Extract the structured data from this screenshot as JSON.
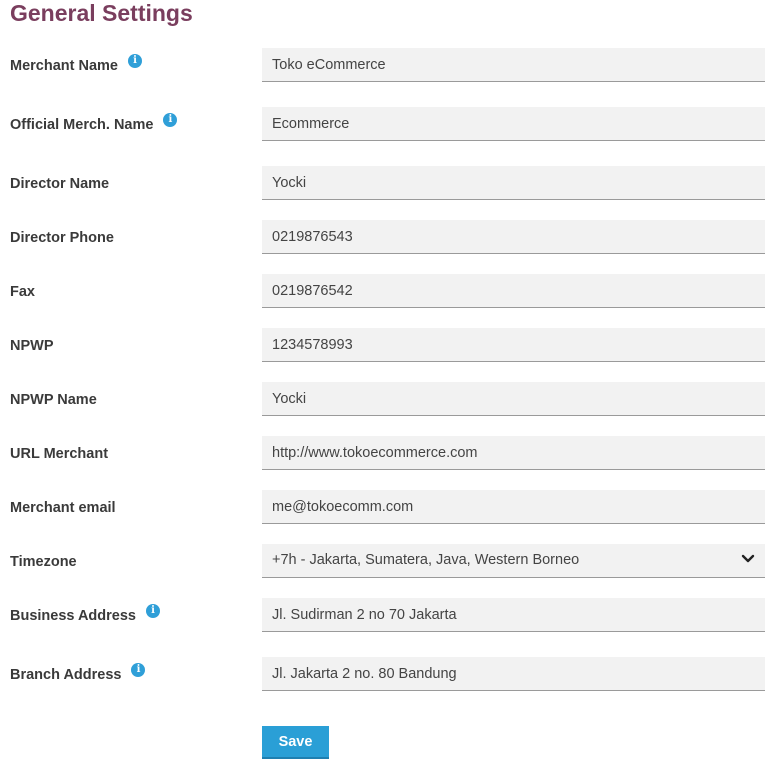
{
  "page": {
    "title": "General Settings"
  },
  "info_icon_glyph": "i",
  "form": {
    "merchant_name": {
      "label": "Merchant Name",
      "value": "Toko eCommerce"
    },
    "official_merchant_name": {
      "label": "Official Merch. Name",
      "value": "Ecommerce"
    },
    "director_name": {
      "label": "Director Name",
      "value": "Yocki"
    },
    "director_phone": {
      "label": "Director Phone",
      "value": "0219876543"
    },
    "fax": {
      "label": "Fax",
      "value": "0219876542"
    },
    "npwp": {
      "label": "NPWP",
      "value": "1234578993"
    },
    "npwp_name": {
      "label": "NPWP Name",
      "value": "Yocki"
    },
    "url_merchant": {
      "label": "URL Merchant",
      "value": "http://www.tokoecommerce.com"
    },
    "merchant_email": {
      "label": "Merchant email",
      "value": "me@tokoecomm.com"
    },
    "timezone": {
      "label": "Timezone",
      "value": "+7h - Jakarta, Sumatera, Java, Western Borneo"
    },
    "business_address": {
      "label": "Business Address",
      "value": "Jl. Sudirman 2 no 70 Jakarta"
    },
    "branch_address": {
      "label": "Branch Address",
      "value": "Jl. Jakarta 2 no. 80 Bandung"
    }
  },
  "actions": {
    "save_label": "Save"
  },
  "colors": {
    "title": "#7a3e5e",
    "info_icon": "#2f9fd8",
    "field_background": "#f2f2f2",
    "save_button": "#2a9fd6"
  },
  "icons": {
    "info": "info-icon",
    "dropdown": "chevron-down-icon"
  }
}
